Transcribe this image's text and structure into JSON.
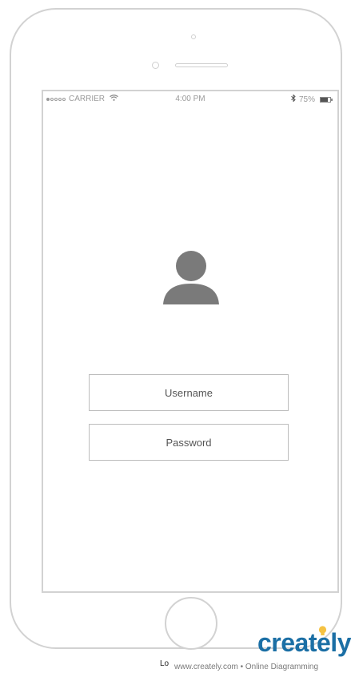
{
  "status_bar": {
    "carrier": "CARRIER",
    "time": "4:00 PM",
    "battery_percent_label": "75%",
    "battery_level": 0.75
  },
  "login": {
    "username_placeholder": "Username",
    "password_placeholder": "Password"
  },
  "footer": {
    "caption": "Lo",
    "watermark_url": "www.creately.com • Online Diagramming",
    "watermark_logo": "creately"
  },
  "colors": {
    "frame": "#d2d2d2",
    "avatar": "#7a7a7a",
    "logo_blue": "#1b6fa5",
    "logo_bulb": "#f5c242"
  },
  "icons": {
    "wifi": "wifi-icon",
    "bluetooth": "bluetooth-icon",
    "battery": "battery-icon",
    "avatar": "user-avatar-icon"
  }
}
